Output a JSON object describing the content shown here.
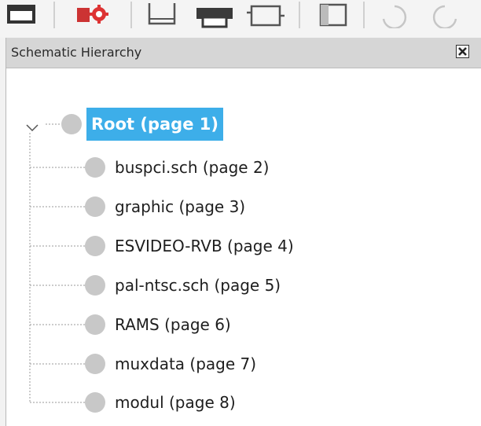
{
  "toolbar": {
    "icons": [
      "window-icon",
      "annotate-gear-icon",
      "hierarchy-sheet-icon",
      "print-icon",
      "sheet-pins-icon",
      "sidebar-icon",
      "undo-icon",
      "redo-icon"
    ]
  },
  "panel": {
    "title": "Schematic Hierarchy"
  },
  "tree": {
    "root": {
      "label": "Root (page 1)",
      "expanded": true,
      "selected": true
    },
    "children": [
      {
        "label": "buspci.sch (page 2)"
      },
      {
        "label": "graphic (page 3)"
      },
      {
        "label": "ESVIDEO-RVB (page 4)"
      },
      {
        "label": "pal-ntsc.sch (page 5)"
      },
      {
        "label": "RAMS (page 6)"
      },
      {
        "label": "muxdata (page 7)"
      },
      {
        "label": "modul (page 8)"
      }
    ]
  },
  "colors": {
    "selection": "#3daee9",
    "header": "#d6d6d6",
    "bullet": "#c8c8c8"
  }
}
